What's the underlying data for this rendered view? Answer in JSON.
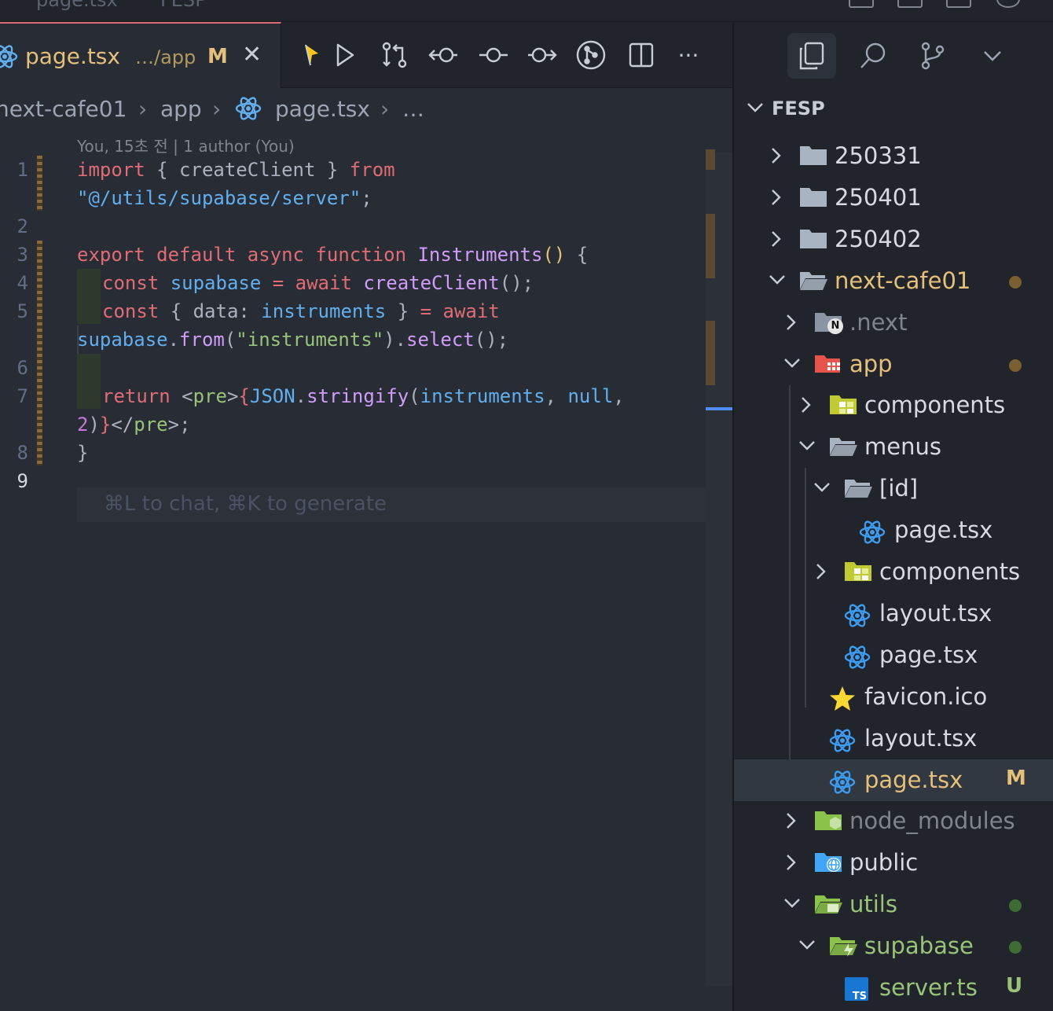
{
  "window": {
    "title_left": "page.tsx",
    "title_right": "FESP"
  },
  "colors": {
    "modified": "#e5c07b",
    "untracked": "#98c379",
    "accent": "#e06c75",
    "selection": "#323842"
  },
  "editor": {
    "tab": {
      "filename": "page.tsx",
      "path": "…/app",
      "status": "M",
      "close": "✕"
    },
    "toolbar_icons": [
      "cursor-spark-icon",
      "run-icon",
      "compare-changes-icon",
      "previous-change-icon",
      "commit-icon",
      "next-change-icon",
      "git-graph-icon",
      "split-editor-icon",
      "more-actions-icon"
    ],
    "toolbar_more": "···",
    "breadcrumb": {
      "root": "next-cafe01",
      "folder": "app",
      "file": "page.tsx",
      "tail": "…"
    },
    "blame": "You, 15초 전 | 1 author (You)",
    "line_numbers": [
      "1",
      "2",
      "3",
      "4",
      "5",
      "6",
      "7",
      "8",
      "9"
    ],
    "code": {
      "l1_import": "import",
      "l1_mid": " { createClient } ",
      "l1_from": "from",
      "l1b_str": "\"@/utils/supabase/server\"",
      "l1b_end": ";",
      "l3_export": "export default async function ",
      "l3_name": "Instruments",
      "l3_parens": "()",
      "l3_brace": " {",
      "l4_const": "const ",
      "l4_var": "supabase",
      "l4_eq": " = ",
      "l4_await": "await ",
      "l4_call": "createClient",
      "l4_end": "();",
      "l5_const": "const ",
      "l5_mid": "{ data: ",
      "l5_var": "instruments",
      "l5_close": " } ",
      "l5_eq": "=",
      "l5_await": " await",
      "l5b_obj": "supabase",
      "l5b_dot": ".",
      "l5b_from": "from",
      "l5b_paren": "(",
      "l5b_str": "\"instruments\"",
      "l5b_rest1": ").",
      "l5b_select": "select",
      "l5b_end": "();",
      "l7_return": "return ",
      "l7_lt": "<",
      "l7_tag": "pre",
      "l7_gt": ">",
      "l7_brace": "{",
      "l7_json": "JSON",
      "l7_dot": ".",
      "l7_stringify": "stringify",
      "l7_paren": "(",
      "l7_arg": "instruments",
      "l7_comma": ", ",
      "l7_null": "null",
      "l7_comma2": ",",
      "l7b_two": "2",
      "l7b_paren": ")",
      "l7b_brace": "}",
      "l7b_lt": "</",
      "l7b_tag": "pre",
      "l7b_end": ">;",
      "l8": "}"
    },
    "chat_hint": "⌘L to chat, ⌘K to generate"
  },
  "explorer": {
    "tab_icons": [
      "explorer-icon",
      "search-icon",
      "source-control-icon",
      "chevron-down-icon"
    ],
    "section_title": "FESP",
    "tree": [
      {
        "name": "250331",
        "type": "folder",
        "expanded": false
      },
      {
        "name": "250401",
        "type": "folder",
        "expanded": false
      },
      {
        "name": "250402",
        "type": "folder",
        "expanded": false
      },
      {
        "name": "next-cafe01",
        "type": "folder",
        "expanded": true,
        "status": "modified"
      },
      {
        "name": ".next",
        "type": "folder-next",
        "expanded": false
      },
      {
        "name": "app",
        "type": "folder-app",
        "expanded": true,
        "status": "modified"
      },
      {
        "name": "components",
        "type": "folder-components",
        "expanded": false
      },
      {
        "name": "menus",
        "type": "folder",
        "expanded": true
      },
      {
        "name": "[id]",
        "type": "folder",
        "expanded": true
      },
      {
        "name": "page.tsx",
        "type": "react-file"
      },
      {
        "name": "components",
        "type": "folder-components",
        "expanded": false
      },
      {
        "name": "layout.tsx",
        "type": "react-file"
      },
      {
        "name": "page.tsx",
        "type": "react-file"
      },
      {
        "name": "favicon.ico",
        "type": "star-file"
      },
      {
        "name": "layout.tsx",
        "type": "react-file"
      },
      {
        "name": "page.tsx",
        "type": "react-file",
        "badge": "M",
        "selected": true
      },
      {
        "name": "node_modules",
        "type": "folder-node",
        "expanded": false
      },
      {
        "name": "public",
        "type": "folder-public",
        "expanded": false
      },
      {
        "name": "utils",
        "type": "folder-utils",
        "expanded": true,
        "status": "untracked"
      },
      {
        "name": "supabase",
        "type": "folder-supabase",
        "expanded": true,
        "status": "untracked"
      },
      {
        "name": "server.ts",
        "type": "ts-file",
        "badge": "U"
      }
    ]
  }
}
